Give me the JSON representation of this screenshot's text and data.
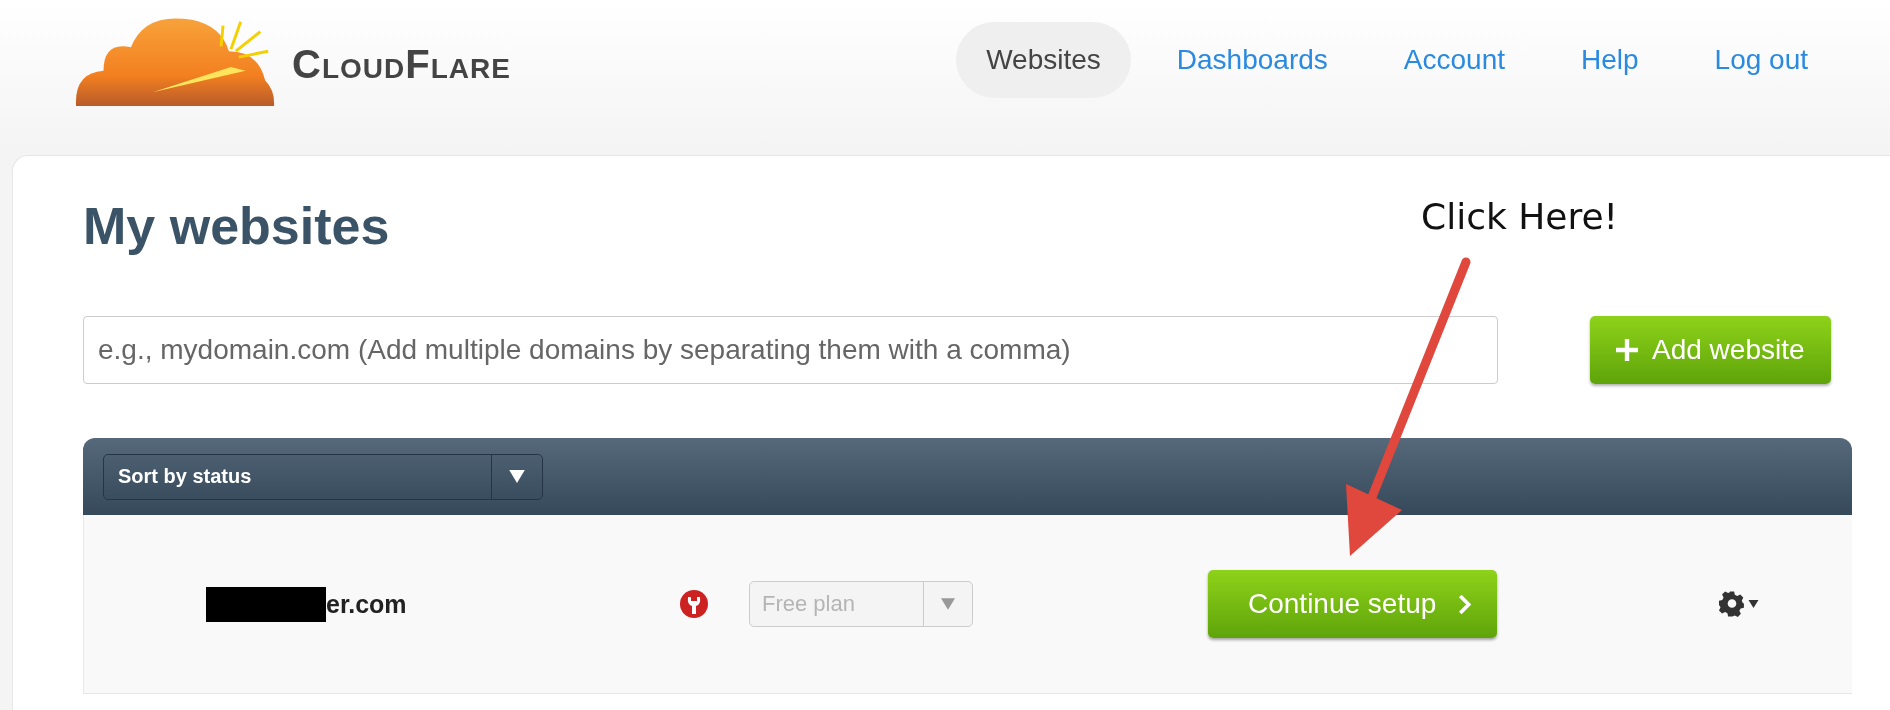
{
  "brand": {
    "name": "CloudFlare"
  },
  "nav": [
    {
      "label": "Websites",
      "selected": true
    },
    {
      "label": "Dashboards",
      "selected": false
    },
    {
      "label": "Account",
      "selected": false
    },
    {
      "label": "Help",
      "selected": false
    },
    {
      "label": "Log out",
      "selected": false
    }
  ],
  "title": "My websites",
  "add_field": {
    "placeholder": "e.g., mydomain.com (Add multiple domains by separating them with a comma)"
  },
  "add_button": "Add website",
  "sort_select": {
    "value": "Sort by status"
  },
  "rows": [
    {
      "domain": "er.com",
      "redacted": true,
      "plan": {
        "value": "Free plan",
        "disabled": true
      },
      "action": "Continue setup"
    }
  ],
  "annotation": {
    "text": "Click Here!"
  }
}
